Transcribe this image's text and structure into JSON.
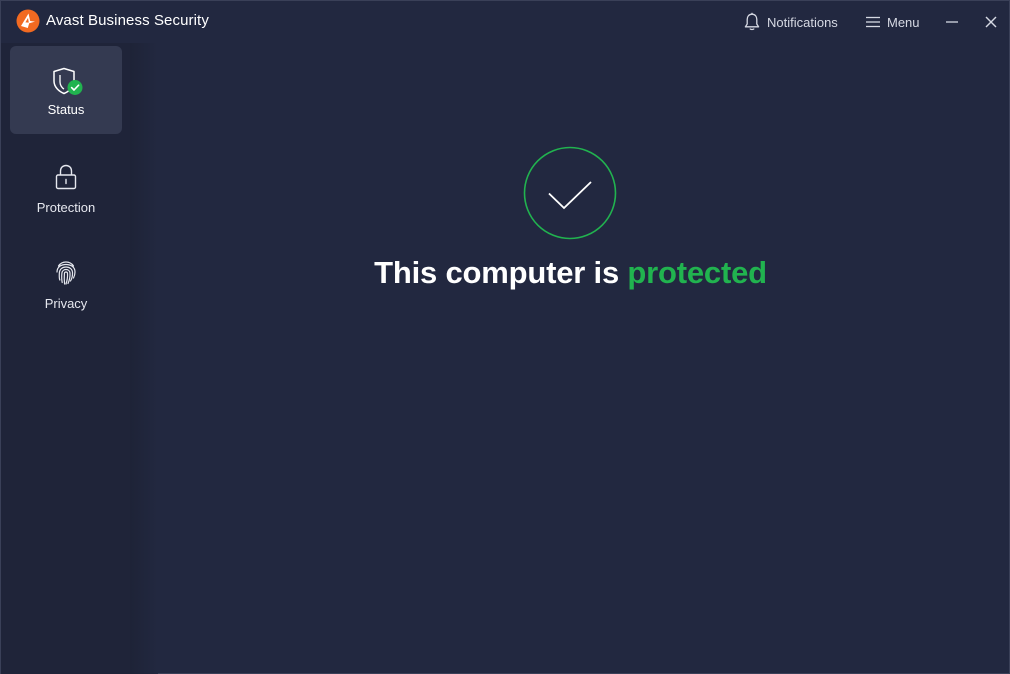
{
  "app": {
    "title": "Avast Business Security",
    "logo_icon": "avast-logo-icon",
    "brand_color": "#f26a21"
  },
  "titlebar": {
    "notifications_label": "Notifications",
    "menu_label": "Menu",
    "minimize_icon": "minimize-icon",
    "close_icon": "close-icon"
  },
  "sidebar": {
    "items": [
      {
        "label": "Status",
        "icon": "shield-check-icon",
        "active": true
      },
      {
        "label": "Protection",
        "icon": "lock-icon",
        "active": false
      },
      {
        "label": "Privacy",
        "icon": "fingerprint-icon",
        "active": false
      }
    ]
  },
  "main": {
    "status_icon": "checkmark-circle-icon",
    "headline_prefix": "This computer is ",
    "headline_status": "protected",
    "accent_color": "#21b34f"
  }
}
